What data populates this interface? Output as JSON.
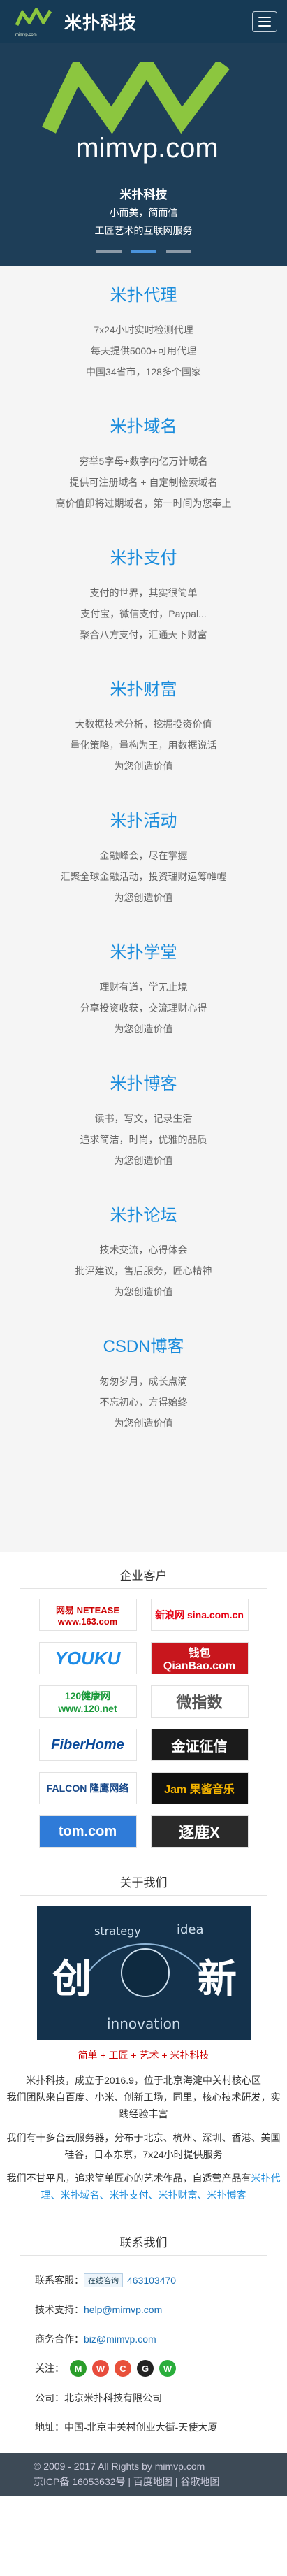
{
  "header": {
    "brand": "米扑科技",
    "logo_sub": "mimvp.com"
  },
  "banner": {
    "domain": "mimvp.com",
    "title": "米扑科技",
    "slogan": "小而美，简而信",
    "tagline": "工匠艺术的互联网服务"
  },
  "services": [
    {
      "title": "米扑代理",
      "lines": [
        "7x24小时实时检测代理",
        "每天提供5000+可用代理",
        "中国34省市，128多个国家"
      ]
    },
    {
      "title": "米扑域名",
      "lines": [
        "穷举5字母+数字内亿万计域名",
        "提供可注册域名 + 自定制检索域名",
        "高价值即将过期域名，第一时间为您奉上"
      ]
    },
    {
      "title": "米扑支付",
      "lines": [
        "支付的世界，其实很简单",
        "支付宝，微信支付，Paypal...",
        "聚合八方支付，汇通天下财富"
      ]
    },
    {
      "title": "米扑财富",
      "lines": [
        "大数据技术分析，挖掘投资价值",
        "量化策略，量构为王，用数据说话",
        "为您创造价值"
      ]
    },
    {
      "title": "米扑活动",
      "lines": [
        "金融峰会，尽在掌握",
        "汇聚全球金融活动，投资理财运筹帷幄",
        "为您创造价值"
      ]
    },
    {
      "title": "米扑学堂",
      "lines": [
        "理财有道，学无止境",
        "分享投资收获，交流理财心得",
        "为您创造价值"
      ]
    },
    {
      "title": "米扑博客",
      "lines": [
        "读书，写文，记录生活",
        "追求简洁，时尚，优雅的品质",
        "为您创造价值"
      ]
    },
    {
      "title": "米扑论坛",
      "lines": [
        "技术交流，心得体会",
        "批评建议，售后服务，匠心精神",
        "为您创造价值"
      ]
    },
    {
      "title": "CSDN博客",
      "lines": [
        "匆匆岁月，成长点滴",
        "不忘初心，方得始终",
        "为您创造价值"
      ]
    }
  ],
  "clients": {
    "title": "企业客户",
    "items": [
      {
        "name": "网易 NETEASE www.163.com"
      },
      {
        "name": "新浪网 sina.com.cn"
      },
      {
        "name": "YOUKU"
      },
      {
        "name": "钱包 QianBao.com"
      },
      {
        "name": "120健康网 www.120.net"
      },
      {
        "name": "微指数"
      },
      {
        "name": "FiberHome"
      },
      {
        "name": "金证征信"
      },
      {
        "name": "FALCON 隆鹰网络"
      },
      {
        "name": "Jam 果酱音乐"
      },
      {
        "name": "tom.com"
      },
      {
        "name": "逐鹿X"
      }
    ]
  },
  "about": {
    "title": "关于我们",
    "img_words": [
      "strategy",
      "idea",
      "创",
      "新",
      "innovation"
    ],
    "tags": [
      "简单",
      "工匠",
      "艺术",
      "米扑科技"
    ],
    "tag_sep": "+",
    "para1": "米扑科技，成立于2016.9，位于北京海淀中关村核心区",
    "para2": "我们团队来自百度、小米、创新工场，同里，核心技术研发，实践经验丰富",
    "para3": "我们有十多台云服务器，分布于北京、杭州、深圳、香港、美国硅谷，日本东京，7x24小时提供服务",
    "para4_prefix": "我们不甘平凡，追求简单匠心的艺术作品，自适营产品有",
    "para4_links": "米扑代理、米扑域名、米扑支付、米扑财富、米扑博客"
  },
  "contact": {
    "title": "联系我们",
    "qq_label": "联系客服：",
    "qq_badge": "在线咨询",
    "qq_number": "463103470",
    "support_label": "技术支持：",
    "support_email": "help@mimvp.com",
    "biz_label": "商务合作：",
    "biz_email": "biz@mimvp.com",
    "follow_label": "关注：",
    "company_label": "公司：",
    "company": "北京米扑科技有限公司",
    "address_label": "地址：",
    "address": "中国-北京中关村创业大街-天使大厦"
  },
  "footer": {
    "copyright": "© 2009 - 2017 All Rights by mimvp.com",
    "icp": "京ICP备 16053632号 | 百度地图 | 谷歌地图"
  },
  "colors": {
    "header_bg": "#163a55",
    "accent": "#1a8cdc",
    "logo_green": "#8cc63f",
    "footer_bg": "#3d4a56"
  }
}
